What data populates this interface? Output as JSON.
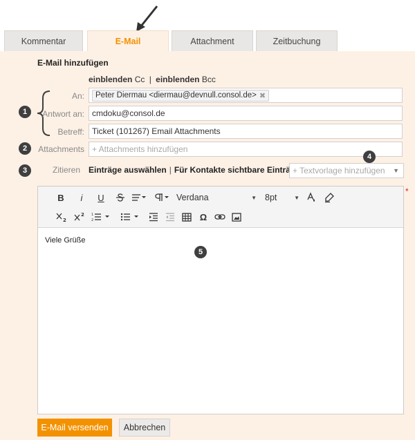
{
  "tabs": [
    {
      "label": "Kommentar"
    },
    {
      "label": "E-Mail"
    },
    {
      "label": "Attachment"
    },
    {
      "label": "Zeitbuchung"
    }
  ],
  "form": {
    "title": "E-Mail hinzufügen",
    "cc_prefix": "einblenden",
    "cc_label": "Cc",
    "separator": "|",
    "bcc_prefix": "einblenden",
    "bcc_label": "Bcc",
    "to_label": "An:",
    "to_recipient": "Peter Diermau <diermau@devnull.consol.de>",
    "to_remove": "✖",
    "reply_label": "Antwort an:",
    "reply_value": "cmdoku@consol.de",
    "subject_label": "Betreff:",
    "subject_value": "Ticket (101267) Email Attachments",
    "attachments_label": "Attachments",
    "attachments_placeholder": "+ Attachments hinzufügen",
    "quote_label": "Zitieren",
    "quote_option_select": "Einträge auswählen",
    "quote_separator": "|",
    "quote_option_visible": "Für Kontakte sichtbare Einträge",
    "template_placeholder": "+ Textvorlage hinzufügen",
    "required_mark": "*"
  },
  "editor": {
    "toolbar": {
      "bold": "B",
      "italic": "i",
      "underline": "U",
      "font": "Verdana",
      "size": "8pt",
      "omega": "Ω"
    },
    "body_text": "Viele Grüße"
  },
  "badges": [
    "1",
    "2",
    "3",
    "4",
    "5"
  ],
  "buttons": {
    "send": "E-Mail versenden",
    "cancel": "Abbrechen"
  },
  "colors": {
    "accent": "#f39200",
    "panel_bg": "#fdf1e6",
    "badge_bg": "#3f3f3f",
    "required": "#d9231d"
  }
}
